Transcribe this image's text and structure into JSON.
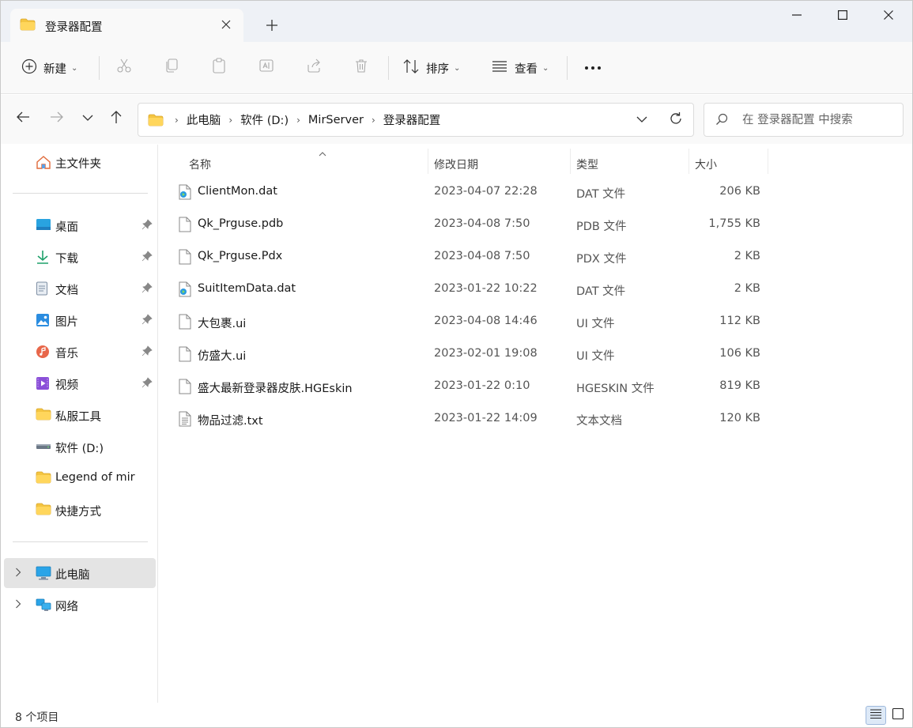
{
  "tab": {
    "title": "登录器配置"
  },
  "toolbar": {
    "new_label": "新建",
    "sort_label": "排序",
    "view_label": "查看"
  },
  "breadcrumb": [
    "此电脑",
    "软件 (D:)",
    "MirServer",
    "登录器配置"
  ],
  "search": {
    "placeholder": "在 登录器配置 中搜索"
  },
  "sidebar": {
    "home": "主文件夹",
    "pinned": [
      "桌面",
      "下载",
      "文档",
      "图片",
      "音乐",
      "视频"
    ],
    "folders": [
      "私服工具",
      "软件 (D:)",
      "Legend of mir",
      "快捷方式"
    ],
    "this_pc": "此电脑",
    "network": "网络"
  },
  "columns": {
    "name": "名称",
    "date": "修改日期",
    "type": "类型",
    "size": "大小"
  },
  "files": [
    {
      "icon": "dat-file-icon",
      "name": "ClientMon.dat",
      "date": "2023-04-07 22:28",
      "type": "DAT 文件",
      "size": "206 KB"
    },
    {
      "icon": "blank-file-icon",
      "name": "Qk_Prguse.pdb",
      "date": "2023-04-08 7:50",
      "type": "PDB 文件",
      "size": "1,755 KB"
    },
    {
      "icon": "blank-file-icon",
      "name": "Qk_Prguse.Pdx",
      "date": "2023-04-08 7:50",
      "type": "PDX 文件",
      "size": "2 KB"
    },
    {
      "icon": "dat-file-icon",
      "name": "SuitItemData.dat",
      "date": "2023-01-22 10:22",
      "type": "DAT 文件",
      "size": "2 KB"
    },
    {
      "icon": "blank-file-icon",
      "name": "大包裹.ui",
      "date": "2023-04-08 14:46",
      "type": "UI 文件",
      "size": "112 KB"
    },
    {
      "icon": "blank-file-icon",
      "name": "仿盛大.ui",
      "date": "2023-02-01 19:08",
      "type": "UI 文件",
      "size": "106 KB"
    },
    {
      "icon": "blank-file-icon",
      "name": "盛大最新登录器皮肤.HGEskin",
      "date": "2023-01-22 0:10",
      "type": "HGESKIN 文件",
      "size": "819 KB"
    },
    {
      "icon": "text-file-icon",
      "name": "物品过滤.txt",
      "date": "2023-01-22 14:09",
      "type": "文本文档",
      "size": "120 KB"
    }
  ],
  "status": {
    "item_count": "8 个项目"
  },
  "colors": {
    "accent": "#0067c0",
    "folder": "#f4c542",
    "selected_bg": "#e4e4e4"
  }
}
